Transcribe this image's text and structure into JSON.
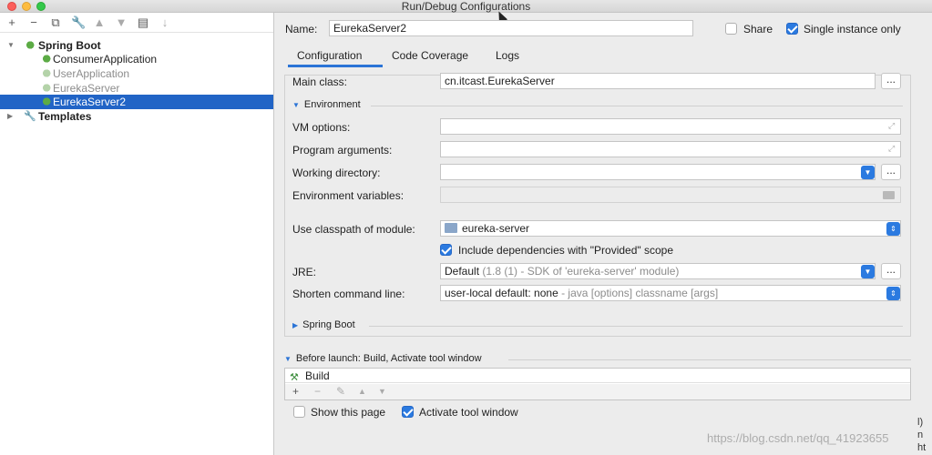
{
  "window": {
    "title": "Run/Debug Configurations"
  },
  "toolbar": {
    "icons": [
      "add-icon",
      "remove-icon",
      "copy-icon",
      "wrench-icon",
      "move-up-icon",
      "move-down-icon",
      "folder-icon",
      "sort-icon"
    ]
  },
  "tree": {
    "spring_boot": "Spring Boot",
    "items": [
      {
        "label": "ConsumerApplication"
      },
      {
        "label": "UserApplication"
      },
      {
        "label": "EurekaServer"
      },
      {
        "label": "EurekaServer2"
      }
    ],
    "templates": "Templates"
  },
  "header": {
    "name_label": "Name:",
    "name_value": "EurekaServer2",
    "share_label": "Share",
    "share_checked": false,
    "single_instance_label": "Single instance only",
    "single_instance_checked": true
  },
  "tabs": [
    {
      "label": "Configuration",
      "active": true
    },
    {
      "label": "Code Coverage",
      "active": false
    },
    {
      "label": "Logs",
      "active": false
    }
  ],
  "config": {
    "main_class_label": "Main class:",
    "main_class_value": "cn.itcast.EurekaServer",
    "environment_label": "Environment",
    "vm_options_label": "VM options:",
    "vm_options_value": "",
    "program_args_label": "Program arguments:",
    "program_args_value": "",
    "working_dir_label": "Working directory:",
    "working_dir_value": "",
    "env_vars_label": "Environment variables:",
    "env_vars_value": "",
    "classpath_label": "Use classpath of module:",
    "classpath_value": "eureka-server",
    "include_deps_label": "Include dependencies with \"Provided\" scope",
    "include_deps_checked": true,
    "jre_label": "JRE:",
    "jre_value_main": "Default",
    "jre_value_hint": "(1.8 (1) - SDK of 'eureka-server' module)",
    "shorten_label": "Shorten command line:",
    "shorten_value_main": "user-local default: none",
    "shorten_value_hint": " - java [options] classname [args]",
    "spring_boot_section": "Spring Boot",
    "dots": "..."
  },
  "before_launch": {
    "label": "Before launch: Build, Activate tool window",
    "items": [
      "Build"
    ]
  },
  "footer": {
    "show_page_label": "Show this page",
    "show_page_checked": false,
    "activate_label": "Activate tool window",
    "activate_checked": true
  },
  "watermark": "https://blog.csdn.net/qq_41923655",
  "edge_glyphs": [
    "l)",
    "n",
    "ht"
  ],
  "colors": {
    "accent": "#2b7ae0",
    "selection": "#2164c6",
    "spring_green": "#5cab45"
  }
}
